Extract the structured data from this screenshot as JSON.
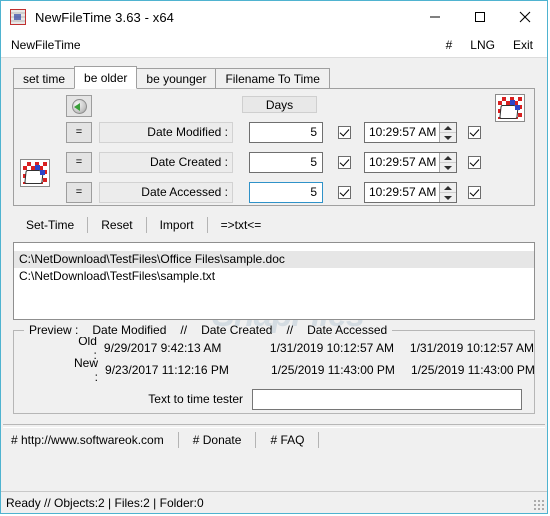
{
  "window": {
    "title": "NewFileTime 3.63 - x64",
    "app_icon": "app-icon",
    "minimize": "minimize-icon",
    "maximize": "maximize-icon",
    "close": "close-icon"
  },
  "menu": {
    "app_name": "NewFileTime",
    "hash": "#",
    "lng": "LNG",
    "exit": "Exit"
  },
  "tabs": [
    {
      "label": "set time",
      "active": false
    },
    {
      "label": "be older",
      "active": true
    },
    {
      "label": "be younger",
      "active": false
    },
    {
      "label": "Filename To Time",
      "active": false
    }
  ],
  "panel": {
    "refresh_icon": "globe-refresh-icon",
    "days_header": "Days",
    "grid_icon_right": "red-grid-hand-icon",
    "grid_icon_left": "red-grid-hand-icon",
    "rows": [
      {
        "equals": "=",
        "label": "Date Modified :",
        "days": "5",
        "days_focused": false,
        "enable_checked": true,
        "time": "10:29:57 AM",
        "time_checked": true
      },
      {
        "equals": "=",
        "label": "Date Created :",
        "days": "5",
        "days_focused": false,
        "enable_checked": true,
        "time": "10:29:57 AM",
        "time_checked": true
      },
      {
        "equals": "=",
        "label": "Date Accessed :",
        "days": "5",
        "days_focused": true,
        "enable_checked": true,
        "time": "10:29:57 AM",
        "time_checked": true
      }
    ]
  },
  "actions": [
    {
      "label": "Set-Time"
    },
    {
      "label": "Reset"
    },
    {
      "label": "Import"
    },
    {
      "label": "=>txt<="
    }
  ],
  "files": [
    {
      "path": "C:\\NetDownload\\TestFiles\\Office Files\\sample.doc",
      "selected": true
    },
    {
      "path": "C:\\NetDownload\\TestFiles\\sample.txt",
      "selected": false
    }
  ],
  "watermark": {
    "text": "SnapFiles"
  },
  "preview": {
    "legend_prefix": "Preview :",
    "legend_col1": "Date Modified",
    "legend_sep1": "//",
    "legend_col2": "Date Created",
    "legend_sep2": "//",
    "legend_col3": "Date Accessed",
    "old_label": "Old :",
    "old_modified": "9/29/2017 9:42:13 AM",
    "old_created": "1/31/2019 10:12:57 AM",
    "old_accessed": "1/31/2019 10:12:57 AM",
    "new_label": "New :",
    "new_modified": "9/23/2017 11:12:16 PM",
    "new_created": "1/25/2019 11:43:00 PM",
    "new_accessed": "1/25/2019 11:43:00 PM"
  },
  "tester": {
    "label": "Text to time tester",
    "value": "",
    "placeholder": ""
  },
  "links": [
    {
      "label": "# http://www.softwareok.com"
    },
    {
      "label": "# Donate"
    },
    {
      "label": "# FAQ"
    }
  ],
  "status": {
    "text": "Ready // Objects:2 | Files:2  | Folder:0",
    "grip": "resize-grip-icon"
  },
  "colors": {
    "window_border": "#4fb3d0",
    "face": "#f0f0f0",
    "focus_border": "#2f92c8",
    "grid_red": "#d82020",
    "grid_blue": "#2b45c8",
    "globe_green": "#3aa03a"
  }
}
